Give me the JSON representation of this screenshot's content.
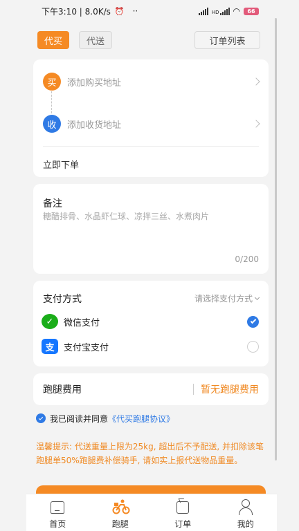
{
  "status_bar": {
    "time_speed": "下午3:10 | 8.0K/s",
    "dots": "··",
    "network_label": "HD",
    "battery": "66"
  },
  "top_tabs": {
    "buy": "代买",
    "deliver": "代送",
    "order_list": "订单列表"
  },
  "address": {
    "buy_badge": "买",
    "buy_placeholder": "添加购买地址",
    "receive_badge": "收",
    "receive_placeholder": "添加收货地址",
    "order_now": "立即下单"
  },
  "note": {
    "title": "备注",
    "placeholder": "糖醋排骨、水晶虾仁球、凉拌三丝、水煮肉片",
    "count": "0/200"
  },
  "payment": {
    "title": "支付方式",
    "select_hint": "请选择支付方式",
    "options": [
      {
        "label": "微信支付",
        "checked": true
      },
      {
        "label": "支付宝支付",
        "checked": false
      }
    ]
  },
  "fee": {
    "title": "跑腿费用",
    "value": "暂无跑腿费用"
  },
  "agreement": {
    "text": "我已阅读并同意",
    "link": "《代买跑腿协议》"
  },
  "tip": "温馨提示: 代送重量上限为25kg, 超出后不予配送, 并扣除该笔跑腿单50%跑腿费补偿骑手, 请如实上报代送物品重量。",
  "tabbar": [
    {
      "label": "首页",
      "icon": "home-icon"
    },
    {
      "label": "跑腿",
      "icon": "rider-icon"
    },
    {
      "label": "订单",
      "icon": "order-icon"
    },
    {
      "label": "我的",
      "icon": "user-icon"
    }
  ],
  "colors": {
    "accent": "#f58a24",
    "link": "#2f7ae5",
    "wechat": "#1aad19",
    "alipay": "#1677ff"
  }
}
